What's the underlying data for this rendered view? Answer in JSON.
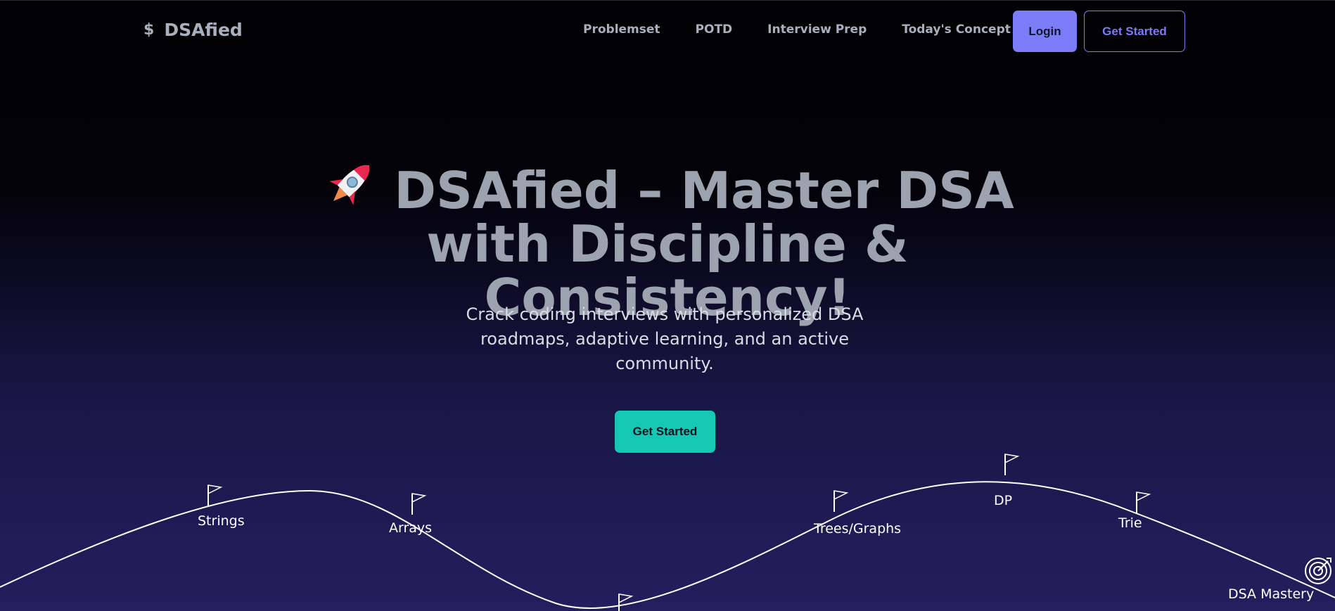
{
  "nav": {
    "logo_icon": "$",
    "logo_text": "DSAfied",
    "links": [
      "Problemset",
      "POTD",
      "Interview Prep",
      "Today's Concept"
    ],
    "login_label": "Login",
    "get_started_label": "Get Started"
  },
  "hero": {
    "rocket_icon": "rocket-icon",
    "title": "DSAfied – Master DSA with Discipline & Consistency!",
    "subtitle": "Crack coding interviews with personalized DSA roadmaps, adaptive learning, and an active community.",
    "cta_label": "Get Started"
  },
  "roadmap": {
    "milestones": [
      "Strings",
      "Arrays",
      "Trees/Graphs",
      "DP",
      "Trie"
    ],
    "goal_label": "DSA Mastery",
    "goal_icon": "target-icon"
  },
  "colors": {
    "accent": "#7c7cf8",
    "cta": "#14c8b4",
    "text_muted": "#9ca3af"
  }
}
